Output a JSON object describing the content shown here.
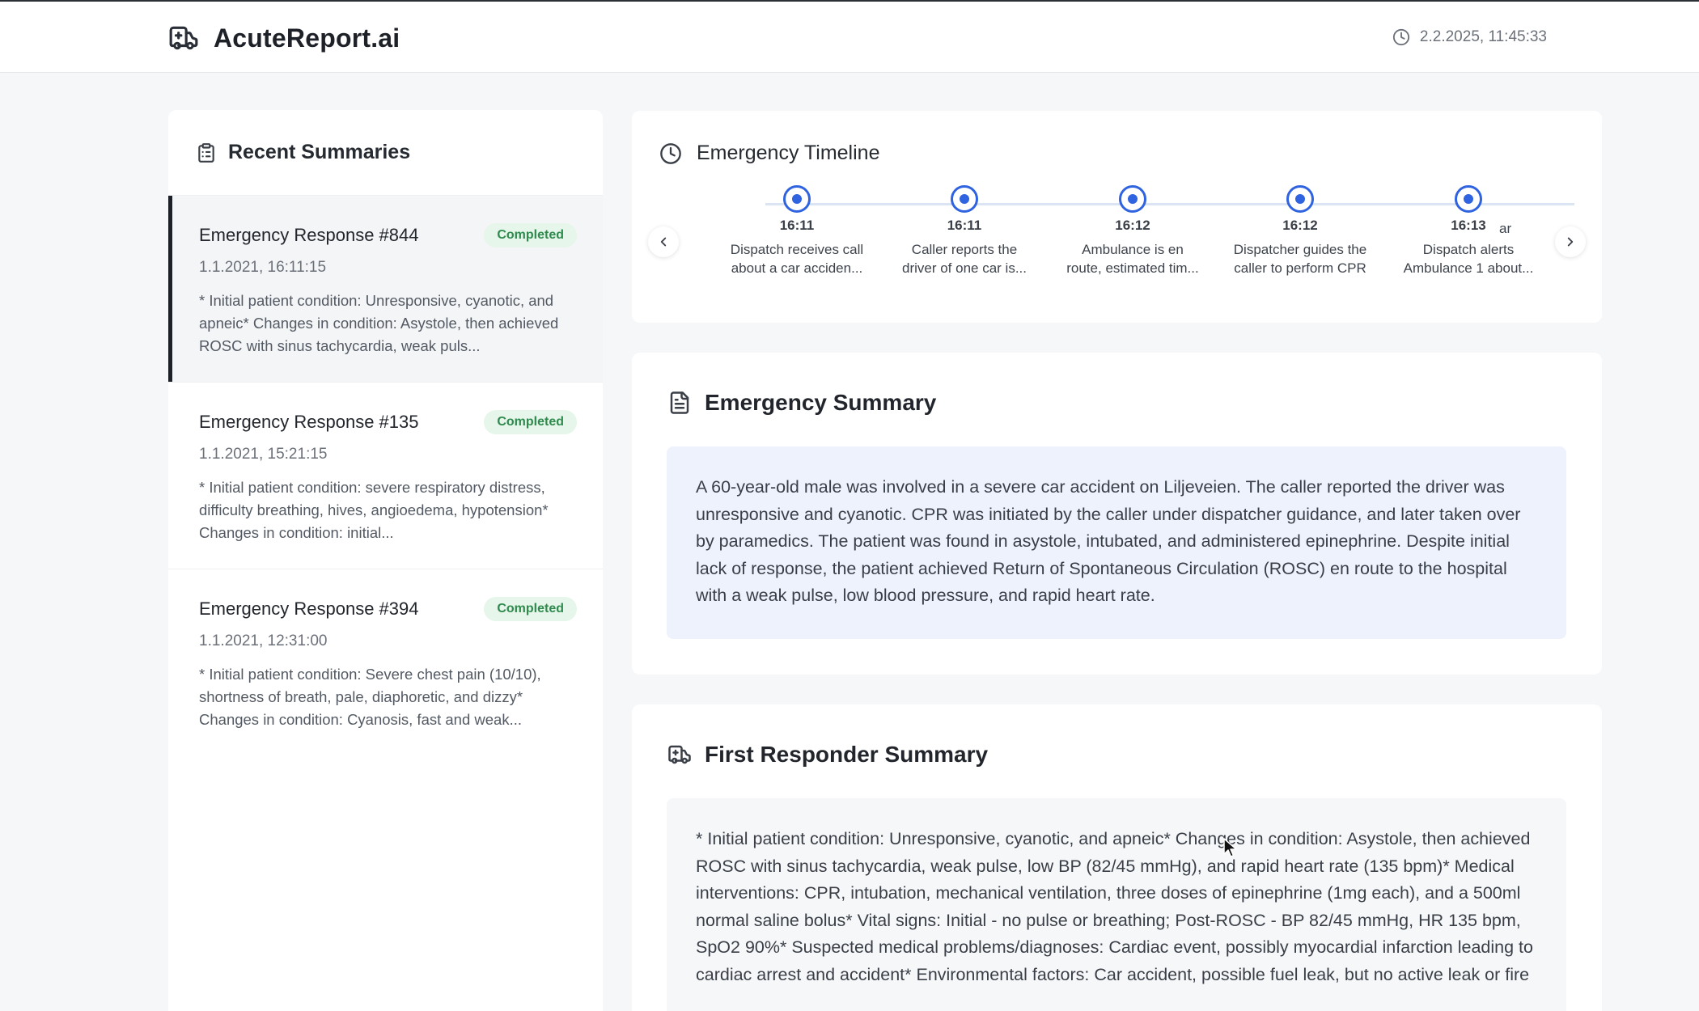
{
  "header": {
    "title": "AcuteReport.ai",
    "datetime": "2.2.2025, 11:45:33"
  },
  "recent": {
    "title": "Recent Summaries",
    "items": [
      {
        "title": "Emergency Response #844",
        "status": "Completed",
        "date": "1.1.2021, 16:11:15",
        "text": "* Initial patient condition: Unresponsive, cyanotic, and apneic* Changes in condition: Asystole, then achieved ROSC with sinus tachycardia, weak puls..."
      },
      {
        "title": "Emergency Response #135",
        "status": "Completed",
        "date": "1.1.2021, 15:21:15",
        "text": "* Initial patient condition: severe respiratory distress, difficulty breathing, hives, angioedema, hypotension* Changes in condition: initial..."
      },
      {
        "title": "Emergency Response #394",
        "status": "Completed",
        "date": "1.1.2021, 12:31:00",
        "text": "* Initial patient condition: Severe chest pain (10/10), shortness of breath, pale, diaphoretic, and dizzy* Changes in condition: Cyanosis, fast and weak..."
      }
    ]
  },
  "timeline": {
    "title": "Emergency Timeline",
    "events": [
      {
        "time": "16:11",
        "line1": "Dispatch receives call",
        "line2": "about a car acciden..."
      },
      {
        "time": "16:11",
        "line1": "Caller reports the",
        "line2": "driver of one car is..."
      },
      {
        "time": "16:12",
        "line1": "Ambulance is en",
        "line2": "route, estimated tim..."
      },
      {
        "time": "16:12",
        "line1": "Dispatcher guides the",
        "line2": "caller to perform CPR"
      },
      {
        "time": "16:13",
        "line1": "Dispatch alerts",
        "line2": "Ambulance 1 about..."
      },
      {
        "time": "",
        "line1": "",
        "line2": "ar"
      }
    ]
  },
  "emergency_summary": {
    "title": "Emergency Summary",
    "text": "A 60-year-old male was involved in a severe car accident on Liljeveien. The caller reported the driver was unresponsive and cyanotic. CPR was initiated by the caller under dispatcher guidance, and later taken over by paramedics. The patient was found in asystole, intubated, and administered epinephrine. Despite initial lack of response, the patient achieved Return of Spontaneous Circulation (ROSC) en route to the hospital with a weak pulse, low blood pressure, and rapid heart rate."
  },
  "first_responder": {
    "title": "First Responder Summary",
    "text": "* Initial patient condition: Unresponsive, cyanotic, and apneic* Changes in condition: Asystole, then achieved ROSC with sinus tachycardia, weak pulse, low BP (82/45 mmHg), and rapid heart rate (135 bpm)* Medical interventions: CPR, intubation, mechanical ventilation, three doses of epinephrine (1mg each), and a 500ml normal saline bolus* Vital signs: Initial - no pulse or breathing; Post-ROSC - BP 82/45 mmHg, HR 135 bpm, SpO2 90%* Suspected medical problems/diagnoses: Cardiac event, possibly myocardial infarction leading to cardiac arrest and accident* Environmental factors: Car accident, possible fuel leak, but no active leak or fire"
  },
  "colors": {
    "accent": "#2f63df",
    "badge_bg": "#e6f6ea",
    "badge_text": "#2f8a4d",
    "summary_bg": "#edf2fc"
  }
}
